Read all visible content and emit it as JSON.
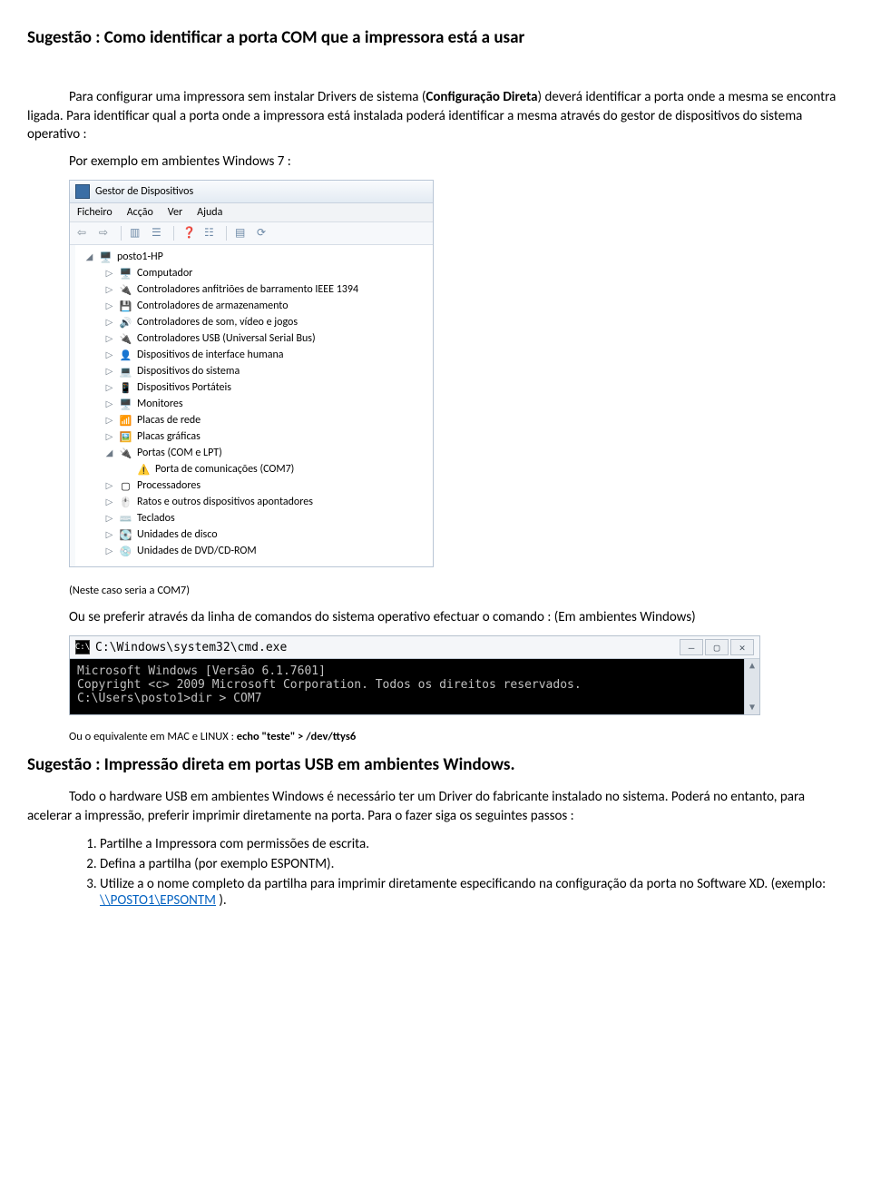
{
  "title1": "Sugestão : Como identificar a porta COM que a impressora está a usar",
  "para1a": "Para configurar uma impressora sem instalar Drivers de sistema (",
  "para1b_bold": "Configuração Direta",
  "para1c": ") deverá identificar a porta onde a mesma se encontra ligada. Para identificar qual a porta onde a impressora está instalada poderá identificar a mesma através do gestor de dispositivos do sistema operativo :",
  "para2": "Por exemplo em ambientes Windows 7 :",
  "devmgr": {
    "title": "Gestor de Dispositivos",
    "menu": [
      "Ficheiro",
      "Acção",
      "Ver",
      "Ajuda"
    ],
    "root": "posto1-HP",
    "items": [
      {
        "icon": "🖥️",
        "label": "Computador",
        "exp": "▷"
      },
      {
        "icon": "🔌",
        "label": "Controladores anfitriões de barramento IEEE 1394",
        "exp": "▷"
      },
      {
        "icon": "💾",
        "label": "Controladores de armazenamento",
        "exp": "▷"
      },
      {
        "icon": "🔊",
        "label": "Controladores de som, vídeo e jogos",
        "exp": "▷"
      },
      {
        "icon": "🔌",
        "label": "Controladores USB (Universal Serial Bus)",
        "exp": "▷"
      },
      {
        "icon": "👤",
        "label": "Dispositivos de interface humana",
        "exp": "▷"
      },
      {
        "icon": "💻",
        "label": "Dispositivos do sistema",
        "exp": "▷"
      },
      {
        "icon": "📱",
        "label": "Dispositivos Portáteis",
        "exp": "▷"
      },
      {
        "icon": "🖥️",
        "label": "Monitores",
        "exp": "▷"
      },
      {
        "icon": "📶",
        "label": "Placas de rede",
        "exp": "▷"
      },
      {
        "icon": "🖼️",
        "label": "Placas gráficas",
        "exp": "▷"
      },
      {
        "icon": "🔌",
        "label": "Portas (COM e LPT)",
        "exp": "◢"
      }
    ],
    "com_child": {
      "icon": "⚠️",
      "label": "Porta de comunicações (COM7)"
    },
    "items2": [
      {
        "icon": "▢",
        "label": "Processadores",
        "exp": "▷"
      },
      {
        "icon": "🖱️",
        "label": "Ratos e outros dispositivos apontadores",
        "exp": "▷"
      },
      {
        "icon": "⌨️",
        "label": "Teclados",
        "exp": "▷"
      },
      {
        "icon": "💽",
        "label": "Unidades de disco",
        "exp": "▷"
      },
      {
        "icon": "💿",
        "label": "Unidades de DVD/CD-ROM",
        "exp": "▷"
      }
    ]
  },
  "note_com7": "(Neste caso seria a COM7)",
  "para3": "Ou se preferir através da linha de comandos do sistema operativo efectuar o comando : (Em ambientes Windows)",
  "cmd": {
    "title": "C:\\Windows\\system32\\cmd.exe",
    "l1": "Microsoft Windows [Versão 6.1.7601]",
    "l2": "Copyright <c> 2009 Microsoft Corporation. Todos os direitos reservados.",
    "l3": "",
    "l4": "C:\\Users\\posto1>dir > COM7"
  },
  "para4a": "Ou  o equivalente em MAC e LINUX : ",
  "para4b_bold": "echo \"teste\" > /dev/ttys6",
  "title2": "Sugestão : Impressão direta em portas USB em ambientes Windows.",
  "para5": "Todo o hardware USB em ambientes Windows é necessário ter um Driver do fabricante instalado no sistema. Poderá no entanto, para acelerar a impressão, preferir imprimir diretamente na porta. Para o fazer siga os seguintes passos :",
  "steps": {
    "s1": "Partilhe a Impressora com permissões de escrita.",
    "s2": "Defina a partilha (por exemplo ESPONTM).",
    "s3a": "Utilize a o nome completo da partilha para imprimir diretamente especificando na configuração da porta no Software XD. (exemplo: ",
    "s3b_link": "\\\\POSTO1\\EPSONTM",
    "s3c": " )."
  }
}
